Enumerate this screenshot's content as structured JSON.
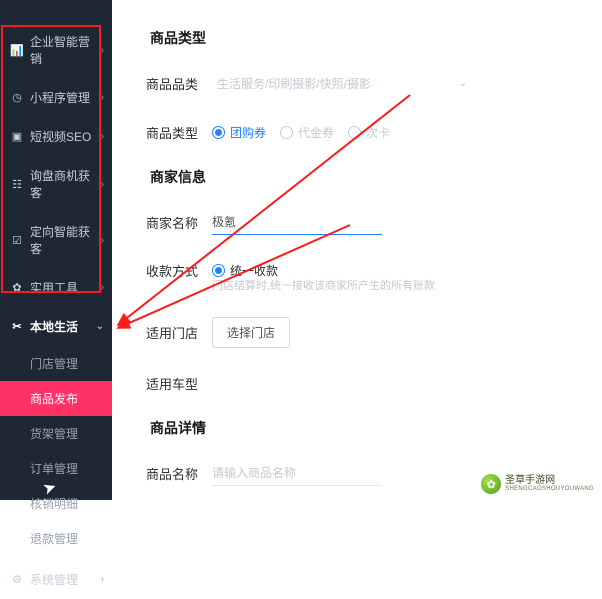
{
  "sidebar": {
    "items": [
      {
        "icon": "📊",
        "label": "企业智能营销"
      },
      {
        "icon": "◷",
        "label": "小程序管理"
      },
      {
        "icon": "▣",
        "label": "短视频SEO"
      },
      {
        "icon": "☷",
        "label": "询盘商机获客"
      },
      {
        "icon": "☑",
        "label": "定向智能获客"
      },
      {
        "icon": "✿",
        "label": "实用工具"
      },
      {
        "icon": "✂",
        "label": "本地生活"
      }
    ],
    "sub": [
      "门店管理",
      "商品发布",
      "货架管理",
      "订单管理",
      "核销明细",
      "退款管理"
    ],
    "last": {
      "icon": "⚙",
      "label": "系统管理"
    }
  },
  "section1": {
    "title": "商品类型",
    "row1_label": "商品品类",
    "row1_placeholder": "生活服务/印刷摄影/快照/摄影",
    "row2_label": "商品类型",
    "radios": [
      "团购券",
      "代金券",
      "次卡"
    ]
  },
  "section2": {
    "title": "商家信息",
    "row1_label": "商家名称",
    "row1_value": "极氪",
    "row2_label": "收款方式",
    "radio": "统一收款",
    "hint": "门店结算时,统一接收该商家所产生的所有账款",
    "row3_label": "适用门店",
    "btn": "选择门店",
    "row4_label": "适用车型"
  },
  "section3": {
    "title": "商品详情",
    "row1_label": "商品名称",
    "row1_placeholder": "请输入商品名称"
  },
  "watermark": {
    "name": "圣草手游网",
    "sub": "SHENGCAOSHOUYOUWANG"
  }
}
